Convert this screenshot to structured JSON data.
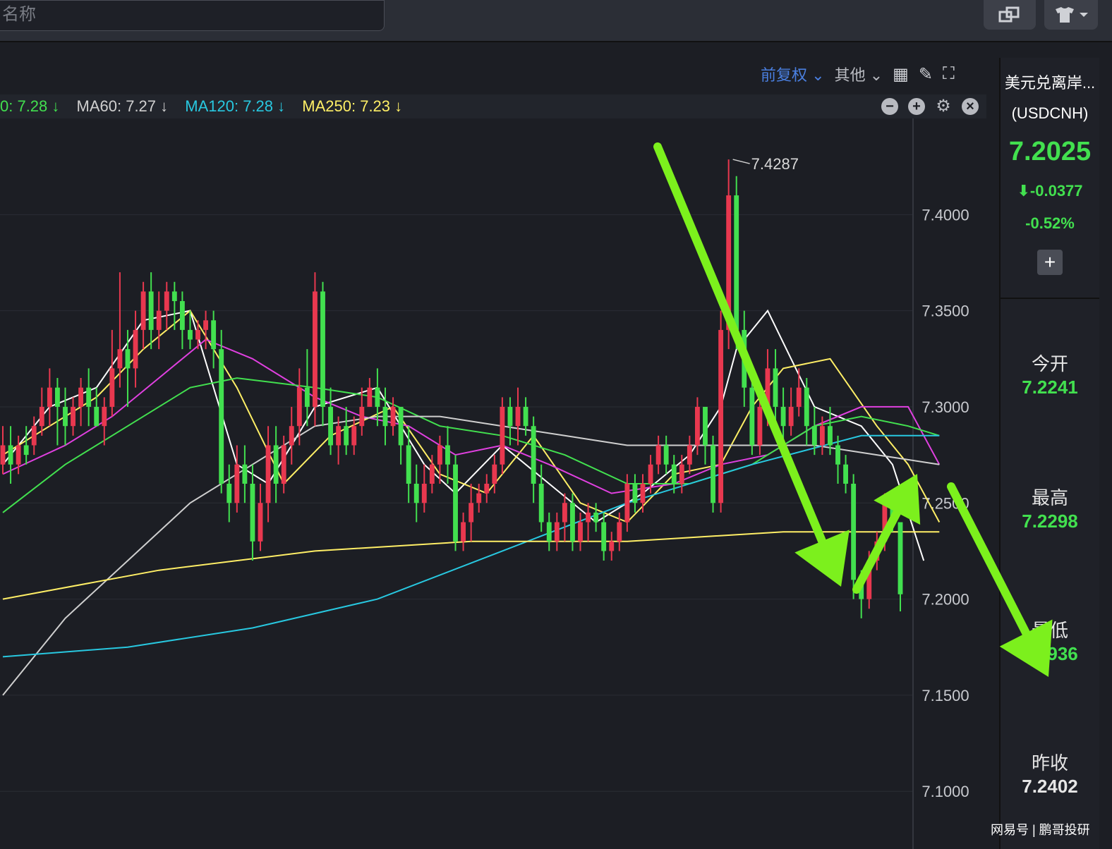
{
  "topbar": {
    "search_placeholder": "名称"
  },
  "toolbar": {
    "adjust_label": "前复权",
    "other_label": "其他"
  },
  "ma_legend": [
    {
      "text": "0: 7.28 ↓",
      "color": "#42e04f"
    },
    {
      "text": "MA60: 7.27 ↓",
      "color": "#cfcfcf"
    },
    {
      "text": "MA120: 7.28 ↓",
      "color": "#28c8e0"
    },
    {
      "text": "MA250: 7.23 ↓",
      "color": "#ffef66"
    }
  ],
  "quote": {
    "name": "美元兑离岸...",
    "code": "(USDCNH)",
    "price": "7.2025",
    "change": "-0.0377",
    "change_pct": "-0.52%",
    "add_label": "+",
    "open_label": "今开",
    "open": "7.2241",
    "high_label": "最高",
    "high": "7.2298",
    "low_label": "最低",
    "low": "7.1936",
    "prev_label": "昨收",
    "prev": "7.2402"
  },
  "colors": {
    "up": "#e8384f",
    "down": "#42e04f",
    "arrow": "#7cf01d",
    "bg": "#1c1e24"
  },
  "watermark": {
    "text": "网易号 | 鹏哥投研"
  },
  "chart_data": {
    "type": "candlestick",
    "title": "",
    "ylim": [
      7.07,
      7.45
    ],
    "y_ticks": [
      "7.1000",
      "7.1500",
      "7.2000",
      "7.2500",
      "7.3000",
      "7.3500",
      "7.4000"
    ],
    "max_label": "7.4287",
    "candles": [
      [
        7.27,
        7.28,
        7.265,
        7.29
      ],
      [
        7.28,
        7.27,
        7.26,
        7.29
      ],
      [
        7.27,
        7.28,
        7.265,
        7.285
      ],
      [
        7.28,
        7.275,
        7.27,
        7.29
      ],
      [
        7.28,
        7.29,
        7.275,
        7.295
      ],
      [
        7.29,
        7.3,
        7.285,
        7.31
      ],
      [
        7.3,
        7.31,
        7.29,
        7.32
      ],
      [
        7.31,
        7.3,
        7.28,
        7.315
      ],
      [
        7.3,
        7.29,
        7.28,
        7.31
      ],
      [
        7.29,
        7.3,
        7.285,
        7.305
      ],
      [
        7.3,
        7.31,
        7.29,
        7.315
      ],
      [
        7.31,
        7.3,
        7.29,
        7.32
      ],
      [
        7.3,
        7.29,
        7.29,
        7.31
      ],
      [
        7.29,
        7.3,
        7.28,
        7.305
      ],
      [
        7.3,
        7.32,
        7.295,
        7.34
      ],
      [
        7.32,
        7.33,
        7.31,
        7.37
      ],
      [
        7.33,
        7.32,
        7.3,
        7.34
      ],
      [
        7.32,
        7.34,
        7.31,
        7.35
      ],
      [
        7.34,
        7.36,
        7.33,
        7.365
      ],
      [
        7.36,
        7.34,
        7.33,
        7.37
      ],
      [
        7.34,
        7.35,
        7.33,
        7.36
      ],
      [
        7.35,
        7.36,
        7.34,
        7.365
      ],
      [
        7.36,
        7.355,
        7.34,
        7.365
      ],
      [
        7.355,
        7.34,
        7.33,
        7.36
      ],
      [
        7.34,
        7.335,
        7.33,
        7.35
      ],
      [
        7.335,
        7.34,
        7.33,
        7.345
      ],
      [
        7.34,
        7.345,
        7.33,
        7.35
      ],
      [
        7.345,
        7.33,
        7.32,
        7.35
      ],
      [
        7.33,
        7.26,
        7.255,
        7.34
      ],
      [
        7.26,
        7.25,
        7.24,
        7.27
      ],
      [
        7.25,
        7.27,
        7.245,
        7.28
      ],
      [
        7.27,
        7.26,
        7.25,
        7.28
      ],
      [
        7.26,
        7.23,
        7.22,
        7.27
      ],
      [
        7.23,
        7.25,
        7.225,
        7.26
      ],
      [
        7.25,
        7.28,
        7.24,
        7.29
      ],
      [
        7.28,
        7.26,
        7.25,
        7.29
      ],
      [
        7.26,
        7.28,
        7.255,
        7.285
      ],
      [
        7.28,
        7.29,
        7.27,
        7.3
      ],
      [
        7.29,
        7.31,
        7.28,
        7.32
      ],
      [
        7.31,
        7.3,
        7.29,
        7.33
      ],
      [
        7.3,
        7.36,
        7.29,
        7.37
      ],
      [
        7.36,
        7.3,
        7.29,
        7.365
      ],
      [
        7.3,
        7.28,
        7.275,
        7.31
      ],
      [
        7.28,
        7.29,
        7.27,
        7.295
      ],
      [
        7.29,
        7.28,
        7.275,
        7.3
      ],
      [
        7.28,
        7.29,
        7.275,
        7.295
      ],
      [
        7.29,
        7.3,
        7.285,
        7.31
      ],
      [
        7.3,
        7.31,
        7.3,
        7.315
      ],
      [
        7.31,
        7.3,
        7.29,
        7.32
      ],
      [
        7.3,
        7.29,
        7.28,
        7.31
      ],
      [
        7.29,
        7.3,
        7.285,
        7.305
      ],
      [
        7.3,
        7.28,
        7.27,
        7.3
      ],
      [
        7.28,
        7.26,
        7.25,
        7.29
      ],
      [
        7.26,
        7.25,
        7.24,
        7.27
      ],
      [
        7.25,
        7.26,
        7.245,
        7.27
      ],
      [
        7.26,
        7.27,
        7.255,
        7.275
      ],
      [
        7.27,
        7.28,
        7.26,
        7.285
      ],
      [
        7.28,
        7.27,
        7.26,
        7.29
      ],
      [
        7.27,
        7.23,
        7.225,
        7.275
      ],
      [
        7.23,
        7.24,
        7.225,
        7.245
      ],
      [
        7.24,
        7.25,
        7.23,
        7.26
      ],
      [
        7.25,
        7.255,
        7.245,
        7.26
      ],
      [
        7.255,
        7.26,
        7.25,
        7.265
      ],
      [
        7.26,
        7.27,
        7.255,
        7.275
      ],
      [
        7.27,
        7.3,
        7.265,
        7.305
      ],
      [
        7.3,
        7.29,
        7.28,
        7.305
      ],
      [
        7.29,
        7.3,
        7.28,
        7.31
      ],
      [
        7.3,
        7.29,
        7.285,
        7.305
      ],
      [
        7.29,
        7.26,
        7.25,
        7.295
      ],
      [
        7.26,
        7.24,
        7.235,
        7.27
      ],
      [
        7.24,
        7.23,
        7.225,
        7.245
      ],
      [
        7.23,
        7.24,
        7.225,
        7.245
      ],
      [
        7.24,
        7.25,
        7.23,
        7.255
      ],
      [
        7.25,
        7.23,
        7.225,
        7.255
      ],
      [
        7.23,
        7.24,
        7.225,
        7.245
      ],
      [
        7.24,
        7.245,
        7.23,
        7.25
      ],
      [
        7.245,
        7.24,
        7.235,
        7.25
      ],
      [
        7.24,
        7.225,
        7.22,
        7.245
      ],
      [
        7.225,
        7.23,
        7.22,
        7.235
      ],
      [
        7.23,
        7.24,
        7.225,
        7.245
      ],
      [
        7.24,
        7.26,
        7.235,
        7.265
      ],
      [
        7.26,
        7.25,
        7.245,
        7.265
      ],
      [
        7.25,
        7.26,
        7.245,
        7.265
      ],
      [
        7.26,
        7.27,
        7.255,
        7.275
      ],
      [
        7.27,
        7.28,
        7.265,
        7.285
      ],
      [
        7.28,
        7.27,
        7.265,
        7.285
      ],
      [
        7.27,
        7.26,
        7.255,
        7.275
      ],
      [
        7.26,
        7.27,
        7.255,
        7.275
      ],
      [
        7.27,
        7.28,
        7.265,
        7.285
      ],
      [
        7.28,
        7.3,
        7.275,
        7.305
      ],
      [
        7.3,
        7.28,
        7.27,
        7.3
      ],
      [
        7.28,
        7.25,
        7.245,
        7.285
      ],
      [
        7.25,
        7.34,
        7.245,
        7.35
      ],
      [
        7.34,
        7.41,
        7.33,
        7.4287
      ],
      [
        7.41,
        7.34,
        7.33,
        7.42
      ],
      [
        7.34,
        7.31,
        7.3,
        7.35
      ],
      [
        7.31,
        7.28,
        7.275,
        7.32
      ],
      [
        7.28,
        7.3,
        7.275,
        7.31
      ],
      [
        7.3,
        7.32,
        7.29,
        7.33
      ],
      [
        7.32,
        7.3,
        7.29,
        7.33
      ],
      [
        7.3,
        7.29,
        7.28,
        7.31
      ],
      [
        7.29,
        7.3,
        7.285,
        7.31
      ],
      [
        7.3,
        7.31,
        7.295,
        7.32
      ],
      [
        7.31,
        7.29,
        7.28,
        7.315
      ],
      [
        7.29,
        7.28,
        7.275,
        7.3
      ],
      [
        7.28,
        7.29,
        7.275,
        7.295
      ],
      [
        7.29,
        7.28,
        7.275,
        7.3
      ],
      [
        7.28,
        7.27,
        7.26,
        7.285
      ],
      [
        7.27,
        7.26,
        7.255,
        7.275
      ],
      [
        7.26,
        7.21,
        7.2,
        7.265
      ],
      [
        7.21,
        7.2,
        7.19,
        7.215
      ],
      [
        7.2,
        7.22,
        7.195,
        7.225
      ],
      [
        7.22,
        7.23,
        7.215,
        7.235
      ],
      [
        7.23,
        7.25,
        7.225,
        7.255
      ],
      [
        7.25,
        7.24,
        7.235,
        7.255
      ],
      [
        7.24,
        7.2025,
        7.1936,
        7.2298
      ]
    ],
    "ma_series": [
      {
        "color": "#ffffff",
        "points": [
          [
            0,
            7.27
          ],
          [
            6,
            7.3
          ],
          [
            12,
            7.31
          ],
          [
            18,
            7.345
          ],
          [
            24,
            7.35
          ],
          [
            30,
            7.27
          ],
          [
            34,
            7.26
          ],
          [
            40,
            7.3
          ],
          [
            48,
            7.31
          ],
          [
            54,
            7.27
          ],
          [
            58,
            7.255
          ],
          [
            64,
            7.28
          ],
          [
            70,
            7.26
          ],
          [
            76,
            7.24
          ],
          [
            82,
            7.255
          ],
          [
            88,
            7.275
          ],
          [
            92,
            7.3
          ],
          [
            94,
            7.33
          ],
          [
            98,
            7.35
          ],
          [
            104,
            7.3
          ],
          [
            110,
            7.29
          ],
          [
            114,
            7.27
          ],
          [
            118,
            7.22
          ]
        ]
      },
      {
        "color": "#ffef66",
        "points": [
          [
            0,
            7.275
          ],
          [
            6,
            7.29
          ],
          [
            12,
            7.305
          ],
          [
            18,
            7.33
          ],
          [
            24,
            7.35
          ],
          [
            30,
            7.31
          ],
          [
            36,
            7.26
          ],
          [
            42,
            7.285
          ],
          [
            50,
            7.3
          ],
          [
            56,
            7.265
          ],
          [
            62,
            7.255
          ],
          [
            68,
            7.285
          ],
          [
            74,
            7.25
          ],
          [
            80,
            7.24
          ],
          [
            86,
            7.265
          ],
          [
            92,
            7.27
          ],
          [
            96,
            7.3
          ],
          [
            100,
            7.32
          ],
          [
            106,
            7.325
          ],
          [
            112,
            7.29
          ],
          [
            116,
            7.27
          ],
          [
            120,
            7.24
          ]
        ]
      },
      {
        "color": "#e040e0",
        "points": [
          [
            0,
            7.265
          ],
          [
            8,
            7.28
          ],
          [
            14,
            7.295
          ],
          [
            20,
            7.315
          ],
          [
            26,
            7.335
          ],
          [
            32,
            7.325
          ],
          [
            40,
            7.305
          ],
          [
            46,
            7.295
          ],
          [
            52,
            7.29
          ],
          [
            58,
            7.275
          ],
          [
            64,
            7.28
          ],
          [
            70,
            7.27
          ],
          [
            78,
            7.255
          ],
          [
            86,
            7.26
          ],
          [
            92,
            7.27
          ],
          [
            98,
            7.275
          ],
          [
            104,
            7.29
          ],
          [
            110,
            7.3
          ],
          [
            116,
            7.3
          ],
          [
            120,
            7.27
          ]
        ]
      },
      {
        "color": "#42e04f",
        "points": [
          [
            0,
            7.245
          ],
          [
            8,
            7.27
          ],
          [
            16,
            7.29
          ],
          [
            24,
            7.31
          ],
          [
            30,
            7.315
          ],
          [
            40,
            7.31
          ],
          [
            48,
            7.305
          ],
          [
            56,
            7.29
          ],
          [
            64,
            7.285
          ],
          [
            72,
            7.275
          ],
          [
            80,
            7.26
          ],
          [
            88,
            7.26
          ],
          [
            96,
            7.27
          ],
          [
            104,
            7.29
          ],
          [
            110,
            7.295
          ],
          [
            116,
            7.29
          ],
          [
            120,
            7.285
          ]
        ]
      },
      {
        "color": "#cfcfcf",
        "points": [
          [
            0,
            7.15
          ],
          [
            8,
            7.19
          ],
          [
            16,
            7.22
          ],
          [
            24,
            7.25
          ],
          [
            32,
            7.27
          ],
          [
            40,
            7.29
          ],
          [
            48,
            7.295
          ],
          [
            56,
            7.295
          ],
          [
            64,
            7.29
          ],
          [
            72,
            7.285
          ],
          [
            80,
            7.28
          ],
          [
            88,
            7.28
          ],
          [
            96,
            7.28
          ],
          [
            104,
            7.28
          ],
          [
            112,
            7.275
          ],
          [
            120,
            7.27
          ]
        ]
      },
      {
        "color": "#28c8e0",
        "points": [
          [
            0,
            7.17
          ],
          [
            16,
            7.175
          ],
          [
            32,
            7.185
          ],
          [
            48,
            7.2
          ],
          [
            64,
            7.225
          ],
          [
            80,
            7.25
          ],
          [
            96,
            7.27
          ],
          [
            110,
            7.285
          ],
          [
            120,
            7.285
          ]
        ]
      },
      {
        "color": "#ffef66",
        "points": [
          [
            0,
            7.2
          ],
          [
            20,
            7.215
          ],
          [
            40,
            7.225
          ],
          [
            60,
            7.23
          ],
          [
            80,
            7.23
          ],
          [
            100,
            7.235
          ],
          [
            120,
            7.235
          ]
        ]
      }
    ]
  }
}
